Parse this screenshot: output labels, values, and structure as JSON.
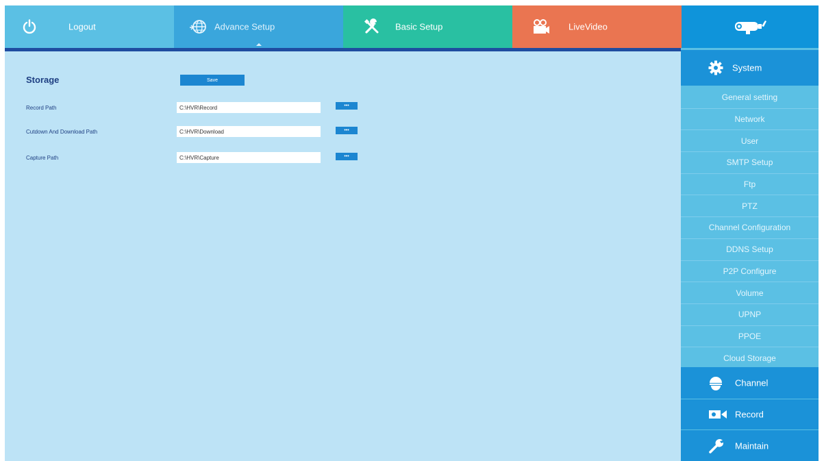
{
  "nav": {
    "logout": "Logout",
    "advance_setup": "Advance Setup",
    "basic_setup": "Basic Setup",
    "live_video": "LiveVideo"
  },
  "storage": {
    "title": "Storage",
    "save_label": "Save",
    "rows": [
      {
        "label": "Record  Path",
        "value": "C:\\HVR\\Record",
        "button": "•••"
      },
      {
        "label": "Cutdown And Download Path",
        "value": "C:\\HVR\\Download",
        "button": "•••"
      },
      {
        "label": "Capture Path",
        "value": "C:\\HVR\\Capture",
        "button": "•••"
      }
    ]
  },
  "sidebar": {
    "system": "System",
    "items": [
      "General setting",
      "Network",
      "User",
      "SMTP Setup",
      "Ftp",
      "PTZ",
      "Channel Configuration",
      "DDNS Setup",
      "P2P Configure",
      "Volume",
      "UPNP",
      "PPOE",
      "Cloud Storage"
    ],
    "channel": "Channel",
    "record": "Record",
    "maintain": "Maintain"
  },
  "colors": {
    "logout_tab": "#5bc0e4",
    "advance_tab": "#3aa6dc",
    "basic_tab": "#29c0a2",
    "live_tab": "#ea7551",
    "logo_tab": "#0f94da",
    "content_bg": "#bde3f6",
    "sidebar_header": "#1b92d8",
    "sidebar_item": "#5bc0e4",
    "button": "#1c86d1"
  },
  "icons": {
    "logout": "power-icon",
    "advance_setup": "globe-icon",
    "basic_setup": "tools-icon",
    "live_video": "video-camera-icon",
    "logo": "camera-logo-icon",
    "system": "gear-icon",
    "channel": "dome-camera-icon",
    "record": "record-camera-icon",
    "maintain": "wrench-icon"
  }
}
